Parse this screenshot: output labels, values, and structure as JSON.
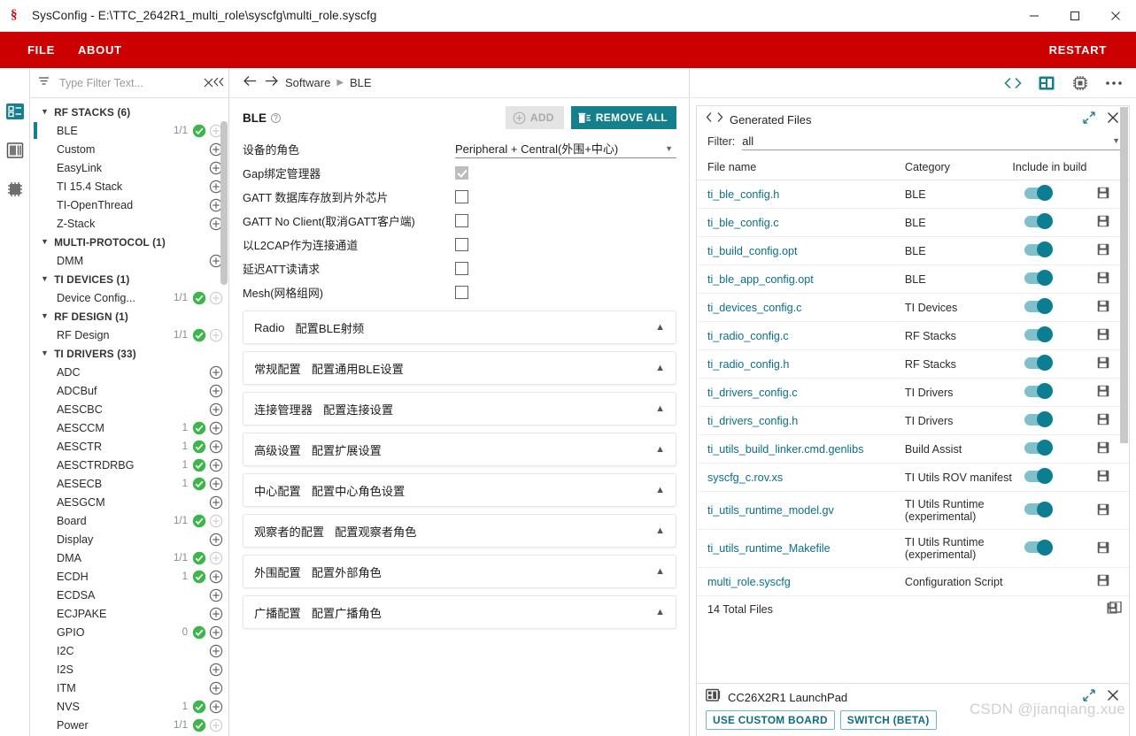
{
  "window": {
    "title": "SysConfig - E:\\TTC_2642R1_multi_role\\syscfg\\multi_role.syscfg",
    "app_icon": "syscfg-logo-icon",
    "minimize": "minimize-icon",
    "maximize": "maximize-icon",
    "close": "close-icon"
  },
  "menubar": {
    "accent_color": "#cc0000",
    "file": "FILE",
    "about": "ABOUT",
    "restart": "RESTART"
  },
  "rail": {
    "items": [
      {
        "name": "software-view-icon",
        "active": true
      },
      {
        "name": "board-view-icon",
        "active": false
      },
      {
        "name": "chip-view-icon",
        "active": false
      }
    ]
  },
  "sidebar": {
    "filter_placeholder": "Type Filter Text...",
    "filter_value": "",
    "clear_label": "✕",
    "collapse_label": "«",
    "groups": [
      {
        "label": "RF STACKS (6)",
        "items": [
          {
            "name": "BLE",
            "count": "1/1",
            "ok": true,
            "plus": "dim",
            "selected": true
          },
          {
            "name": "Custom",
            "count": "",
            "ok": false,
            "plus": "on",
            "selected": false
          },
          {
            "name": "EasyLink",
            "count": "",
            "ok": false,
            "plus": "on",
            "selected": false
          },
          {
            "name": "TI 15.4 Stack",
            "count": "",
            "ok": false,
            "plus": "on",
            "selected": false
          },
          {
            "name": "TI-OpenThread",
            "count": "",
            "ok": false,
            "plus": "on",
            "selected": false
          },
          {
            "name": "Z-Stack",
            "count": "",
            "ok": false,
            "plus": "on",
            "selected": false
          }
        ]
      },
      {
        "label": "MULTI-PROTOCOL (1)",
        "items": [
          {
            "name": "DMM",
            "count": "",
            "ok": false,
            "plus": "on",
            "selected": false
          }
        ]
      },
      {
        "label": "TI DEVICES (1)",
        "items": [
          {
            "name": "Device Config...",
            "count": "1/1",
            "ok": true,
            "plus": "dim",
            "selected": false
          }
        ]
      },
      {
        "label": "RF DESIGN (1)",
        "items": [
          {
            "name": "RF Design",
            "count": "1/1",
            "ok": true,
            "plus": "dim",
            "selected": false
          }
        ]
      },
      {
        "label": "TI DRIVERS (33)",
        "items": [
          {
            "name": "ADC",
            "count": "",
            "ok": false,
            "plus": "on",
            "selected": false
          },
          {
            "name": "ADCBuf",
            "count": "",
            "ok": false,
            "plus": "on",
            "selected": false
          },
          {
            "name": "AESCBC",
            "count": "",
            "ok": false,
            "plus": "on",
            "selected": false
          },
          {
            "name": "AESCCM",
            "count": "1",
            "ok": true,
            "plus": "on",
            "selected": false
          },
          {
            "name": "AESCTR",
            "count": "1",
            "ok": true,
            "plus": "on",
            "selected": false
          },
          {
            "name": "AESCTRDRBG",
            "count": "1",
            "ok": true,
            "plus": "on",
            "selected": false
          },
          {
            "name": "AESECB",
            "count": "1",
            "ok": true,
            "plus": "on",
            "selected": false
          },
          {
            "name": "AESGCM",
            "count": "",
            "ok": false,
            "plus": "on",
            "selected": false
          },
          {
            "name": "Board",
            "count": "1/1",
            "ok": true,
            "plus": "dim",
            "selected": false
          },
          {
            "name": "Display",
            "count": "",
            "ok": false,
            "plus": "on",
            "selected": false
          },
          {
            "name": "DMA",
            "count": "1/1",
            "ok": true,
            "plus": "dim",
            "selected": false
          },
          {
            "name": "ECDH",
            "count": "1",
            "ok": true,
            "plus": "on",
            "selected": false
          },
          {
            "name": "ECDSA",
            "count": "",
            "ok": false,
            "plus": "on",
            "selected": false
          },
          {
            "name": "ECJPAKE",
            "count": "",
            "ok": false,
            "plus": "on",
            "selected": false
          },
          {
            "name": "GPIO",
            "count": "0",
            "ok": true,
            "plus": "on",
            "selected": false
          },
          {
            "name": "I2C",
            "count": "",
            "ok": false,
            "plus": "on",
            "selected": false
          },
          {
            "name": "I2S",
            "count": "",
            "ok": false,
            "plus": "on",
            "selected": false
          },
          {
            "name": "ITM",
            "count": "",
            "ok": false,
            "plus": "on",
            "selected": false
          },
          {
            "name": "NVS",
            "count": "1",
            "ok": true,
            "plus": "on",
            "selected": false
          },
          {
            "name": "Power",
            "count": "1/1",
            "ok": true,
            "plus": "dim",
            "selected": false
          }
        ]
      }
    ]
  },
  "center": {
    "breadcrumb": {
      "back": "←",
      "forward": "→",
      "root": "Software",
      "leaf": "BLE"
    },
    "module_title": "BLE",
    "help_badge": "?",
    "add_label": "ADD",
    "remove_all_label": "REMOVE ALL",
    "options": [
      {
        "label": "设备的角色",
        "type": "select",
        "value": "Peripheral + Central(外围+中心)"
      },
      {
        "label": "Gap绑定管理器",
        "type": "checkbox",
        "checked": true
      },
      {
        "label": "GATT 数据库存放到片外芯片",
        "type": "checkbox",
        "checked": false
      },
      {
        "label": "GATT No Client(取消GATT客户端)",
        "type": "checkbox",
        "checked": false
      },
      {
        "label": "以L2CAP作为连接通道",
        "type": "checkbox",
        "checked": false
      },
      {
        "label": "延迟ATT读请求",
        "type": "checkbox",
        "checked": false
      },
      {
        "label": "Mesh(网格组网)",
        "type": "checkbox",
        "checked": false
      }
    ],
    "sections": [
      {
        "title": "Radio",
        "subtitle": "配置BLE射频",
        "expanded": false
      },
      {
        "title": "常规配置",
        "subtitle": "配置通用BLE设置",
        "expanded": false
      },
      {
        "title": "连接管理器",
        "subtitle": "配置连接设置",
        "expanded": false
      },
      {
        "title": "高级设置",
        "subtitle": "配置扩展设置",
        "expanded": false
      },
      {
        "title": "中心配置",
        "subtitle": "配置中心角色设置",
        "expanded": false
      },
      {
        "title": "观察者的配置",
        "subtitle": "配置观察者角色",
        "expanded": false
      },
      {
        "title": "外围配置",
        "subtitle": "配置外部角色",
        "expanded": false
      },
      {
        "title": "广播配置",
        "subtitle": "配置广播角色",
        "expanded": false
      }
    ]
  },
  "right_toolbar": {
    "icons": [
      "code-icon",
      "board-icon",
      "chip-icon",
      "more-options-icon"
    ]
  },
  "generated_files": {
    "panel_icon": "code-brackets-icon",
    "panel_title": "Generated Files",
    "expand_icon": "expand-icon",
    "close_icon": "close-icon",
    "filter_label": "Filter:",
    "filter_value": "all",
    "columns": [
      "File name",
      "Category",
      "Include in build"
    ],
    "rows": [
      {
        "file": "ti_ble_config.h",
        "category": "BLE",
        "included": true,
        "save": "save-icon"
      },
      {
        "file": "ti_ble_config.c",
        "category": "BLE",
        "included": true,
        "save": "save-icon"
      },
      {
        "file": "ti_build_config.opt",
        "category": "BLE",
        "included": true,
        "save": "save-icon"
      },
      {
        "file": "ti_ble_app_config.opt",
        "category": "BLE",
        "included": true,
        "save": "save-icon"
      },
      {
        "file": "ti_devices_config.c",
        "category": "TI Devices",
        "included": true,
        "save": "save-icon"
      },
      {
        "file": "ti_radio_config.c",
        "category": "RF Stacks",
        "included": true,
        "save": "save-icon"
      },
      {
        "file": "ti_radio_config.h",
        "category": "RF Stacks",
        "included": true,
        "save": "save-icon"
      },
      {
        "file": "ti_drivers_config.c",
        "category": "TI Drivers",
        "included": true,
        "save": "save-icon"
      },
      {
        "file": "ti_drivers_config.h",
        "category": "TI Drivers",
        "included": true,
        "save": "save-icon"
      },
      {
        "file": "ti_utils_build_linker.cmd.genlibs",
        "category": "Build Assist",
        "included": true,
        "save": "save-icon"
      },
      {
        "file": "syscfg_c.rov.xs",
        "category": "TI Utils ROV manifest",
        "included": true,
        "save": "save-icon"
      },
      {
        "file": "ti_utils_runtime_model.gv",
        "category": "TI Utils Runtime (experimental)",
        "included": true,
        "save": "save-icon"
      },
      {
        "file": "ti_utils_runtime_Makefile",
        "category": "TI Utils Runtime (experimental)",
        "included": true,
        "save": "save-icon"
      },
      {
        "file": "multi_role.syscfg",
        "category": "Configuration Script",
        "included": null,
        "save": "save-icon"
      }
    ],
    "total_label": "14 Total Files",
    "save_all_icon": "save-all-icon"
  },
  "board_panel": {
    "panel_icon": "board-icon",
    "title": "CC26X2R1 LaunchPad",
    "expand_icon": "expand-icon",
    "close_icon": "close-icon",
    "buttons": [
      "USE CUSTOM BOARD",
      "SWITCH (BETA)"
    ]
  },
  "watermark": "CSDN @jianqiang.xue",
  "colors": {
    "brand_red": "#cc0000",
    "teal": "#147f8d",
    "link": "#0a6f86",
    "green_ok": "#3cb54a"
  }
}
